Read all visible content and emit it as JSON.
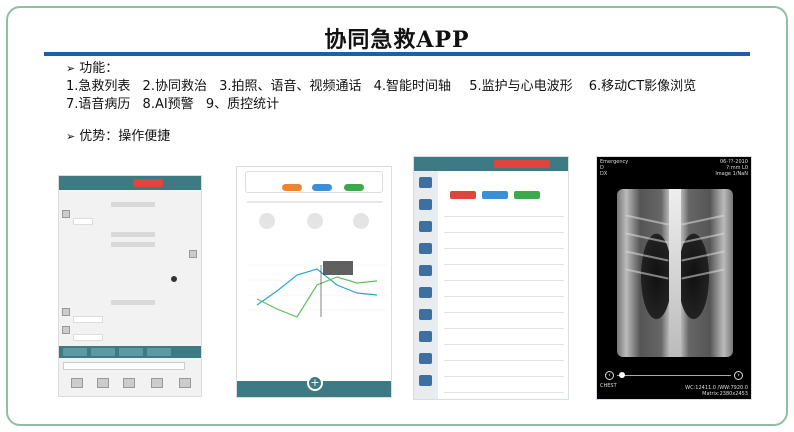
{
  "slide": {
    "title": "协同急救APP",
    "features_heading": "功能：",
    "features_line1": [
      "1.急救列表",
      "2.协同救治",
      "3.拍照、语音、视频通话",
      "4.智能时间轴",
      "5.监护与心电波形",
      "6.移动CT影像浏览"
    ],
    "features_line2": [
      "7.语音病历",
      "8.AI预警",
      "9、质控统计"
    ],
    "advantage": "优势：操作便捷"
  },
  "xray": {
    "top_left": [
      "Emergency",
      "D",
      "DX"
    ],
    "top_right": [
      "06-??-2010",
      "?:mm L0",
      "Image 1/NaN"
    ],
    "bottom_left": "CHEST",
    "bottom_right": [
      "WC:12411.0 /WW:7920.0",
      "Matrix:2380x2453"
    ]
  },
  "colors": {
    "accent_blue": "#1f5fa8",
    "app_teal": "#3d7a84",
    "alert_red": "#e0443c",
    "frame_green": "#8fbf9f"
  }
}
